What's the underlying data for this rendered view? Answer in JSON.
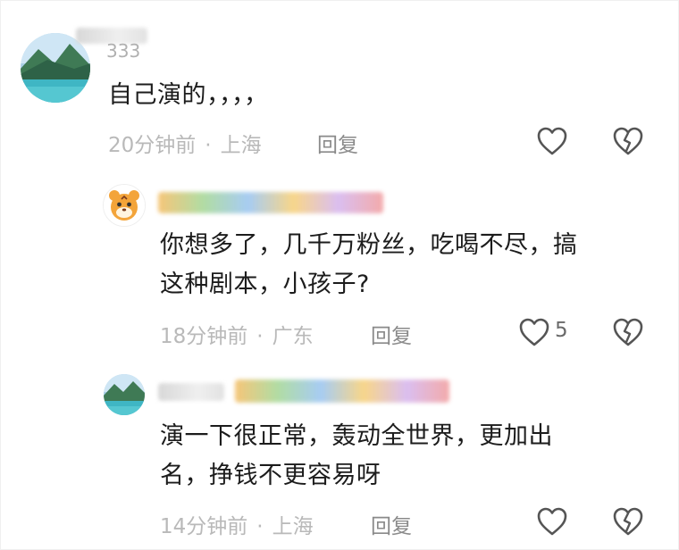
{
  "comments": [
    {
      "username": "333",
      "text": "自己演的，，，，",
      "time": "20分钟前",
      "location": "上海",
      "reply_label": "回复"
    },
    {
      "text_line1": "你想多了，几千万粉丝，吃喝不尽，搞",
      "text_line2": "这种剧本，小孩子?",
      "time": "18分钟前",
      "location": "广东",
      "reply_label": "回复",
      "like_count": "5"
    },
    {
      "text_line1": "演一下很正常，轰动全世界，更加出",
      "text_line2": "名，挣钱不更容易呀",
      "time": "14分钟前",
      "location": "上海",
      "reply_label": "回复"
    }
  ],
  "separator": "·",
  "colors": {
    "text": "#1c1c1c",
    "meta": "#b9b9b9",
    "reply": "#8a8a8a",
    "icon": "#555555"
  },
  "icons": [
    "heart-outline-icon",
    "broken-heart-icon"
  ]
}
